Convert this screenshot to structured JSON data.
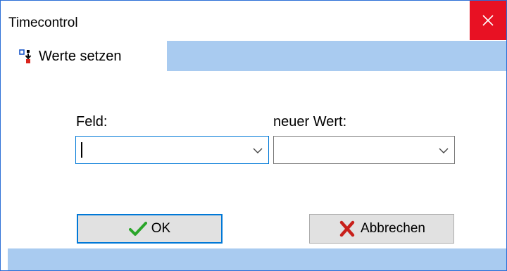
{
  "window": {
    "title": "Timecontrol",
    "close_icon": "close-icon",
    "close_color": "#e81123"
  },
  "tabs": [
    {
      "label": "Werte setzen",
      "icon": "set-values-icon",
      "active": true
    }
  ],
  "form": {
    "field_label": "Feld:",
    "field_value": "",
    "new_value_label": "neuer Wert:",
    "new_value_value": ""
  },
  "buttons": {
    "ok_label": "OK",
    "ok_icon": "checkmark-icon",
    "cancel_label": "Abbrechen",
    "cancel_icon": "cross-icon"
  },
  "colors": {
    "accent": "#0078d7",
    "strip": "#a9cbf0",
    "ok_check": "#2aa52a",
    "cancel_cross": "#c8201b"
  }
}
